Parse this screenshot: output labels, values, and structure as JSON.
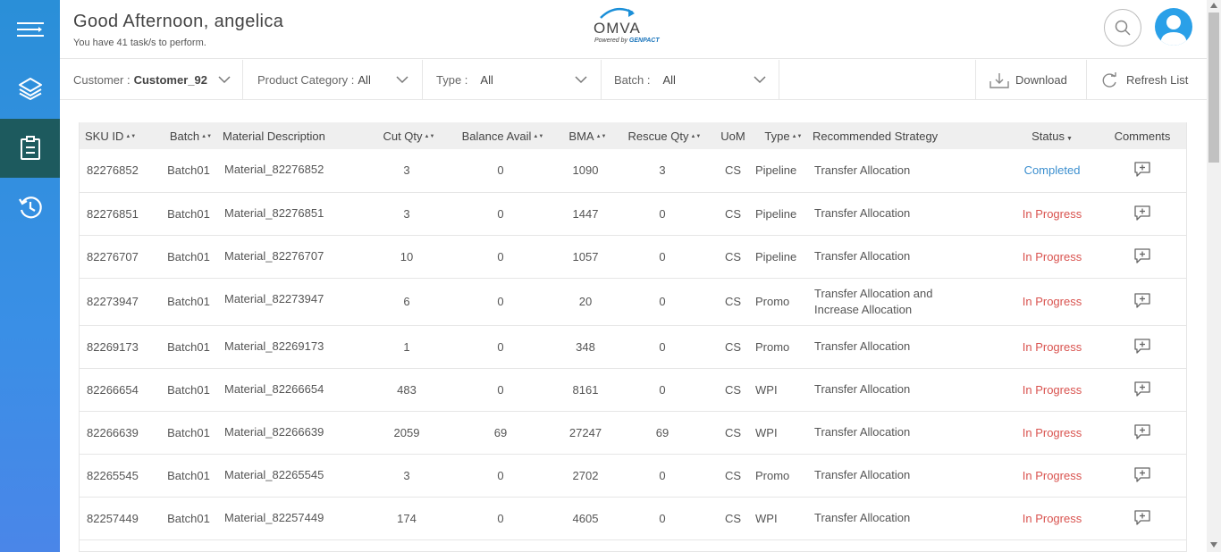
{
  "header": {
    "greeting": "Good Afternoon, angelica",
    "subtitle": "You have 41 task/s to perform.",
    "logo_name": "OMVA",
    "logo_powered": "Powered by",
    "logo_brand": "GENPACT"
  },
  "sidebar": {
    "items": [
      {
        "icon": "menu-icon"
      },
      {
        "icon": "layers-icon"
      },
      {
        "icon": "clipboard-icon",
        "active": true
      },
      {
        "icon": "history-icon"
      }
    ]
  },
  "filters": {
    "customer_label": "Customer :",
    "customer_value": "Customer_92",
    "category_label": "Product Category :",
    "category_value": "All",
    "type_label": "Type :",
    "type_value": "All",
    "batch_label": "Batch :",
    "batch_value": "All",
    "download_label": "Download",
    "refresh_label": "Refresh List"
  },
  "table": {
    "columns": [
      "SKU ID",
      "Batch",
      "Material Description",
      "Cut Qty",
      "Balance Avail",
      "BMA",
      "Rescue Qty",
      "UoM",
      "Type",
      "Recommended Strategy",
      "Status",
      "Comments"
    ],
    "rows": [
      {
        "sku": "82276852",
        "batch": "Batch01",
        "material": "Material_82276852",
        "cut": "3",
        "balance": "0",
        "bma": "1090",
        "rescue": "3",
        "uom": "CS",
        "type": "Pipeline",
        "strategy": "Transfer Allocation",
        "status": "Completed"
      },
      {
        "sku": "82276851",
        "batch": "Batch01",
        "material": "Material_82276851",
        "cut": "3",
        "balance": "0",
        "bma": "1447",
        "rescue": "0",
        "uom": "CS",
        "type": "Pipeline",
        "strategy": "Transfer Allocation",
        "status": "In Progress"
      },
      {
        "sku": "82276707",
        "batch": "Batch01",
        "material": "Material_82276707",
        "cut": "10",
        "balance": "0",
        "bma": "1057",
        "rescue": "0",
        "uom": "CS",
        "type": "Pipeline",
        "strategy": "Transfer Allocation",
        "status": "In Progress"
      },
      {
        "sku": "82273947",
        "batch": "Batch01",
        "material": "Material_82273947",
        "cut": "6",
        "balance": "0",
        "bma": "20",
        "rescue": "0",
        "uom": "CS",
        "type": "Promo",
        "strategy": "Transfer Allocation and Increase Allocation",
        "status": "In Progress"
      },
      {
        "sku": "82269173",
        "batch": "Batch01",
        "material": "Material_82269173",
        "cut": "1",
        "balance": "0",
        "bma": "348",
        "rescue": "0",
        "uom": "CS",
        "type": "Promo",
        "strategy": "Transfer Allocation",
        "status": "In Progress"
      },
      {
        "sku": "82266654",
        "batch": "Batch01",
        "material": "Material_82266654",
        "cut": "483",
        "balance": "0",
        "bma": "8161",
        "rescue": "0",
        "uom": "CS",
        "type": "WPI",
        "strategy": "Transfer Allocation",
        "status": "In Progress"
      },
      {
        "sku": "82266639",
        "batch": "Batch01",
        "material": "Material_82266639",
        "cut": "2059",
        "balance": "69",
        "bma": "27247",
        "rescue": "69",
        "uom": "CS",
        "type": "WPI",
        "strategy": "Transfer Allocation",
        "status": "In Progress"
      },
      {
        "sku": "82265545",
        "batch": "Batch01",
        "material": "Material_82265545",
        "cut": "3",
        "balance": "0",
        "bma": "2702",
        "rescue": "0",
        "uom": "CS",
        "type": "Promo",
        "strategy": "Transfer Allocation",
        "status": "In Progress"
      },
      {
        "sku": "82257449",
        "batch": "Batch01",
        "material": "Material_82257449",
        "cut": "174",
        "balance": "0",
        "bma": "4605",
        "rescue": "0",
        "uom": "CS",
        "type": "WPI",
        "strategy": "Transfer Allocation",
        "status": "In Progress"
      }
    ]
  },
  "colors": {
    "completed": "#3c8fcf",
    "in_progress": "#d9534f",
    "sidebar_active": "#1d5a5e"
  }
}
